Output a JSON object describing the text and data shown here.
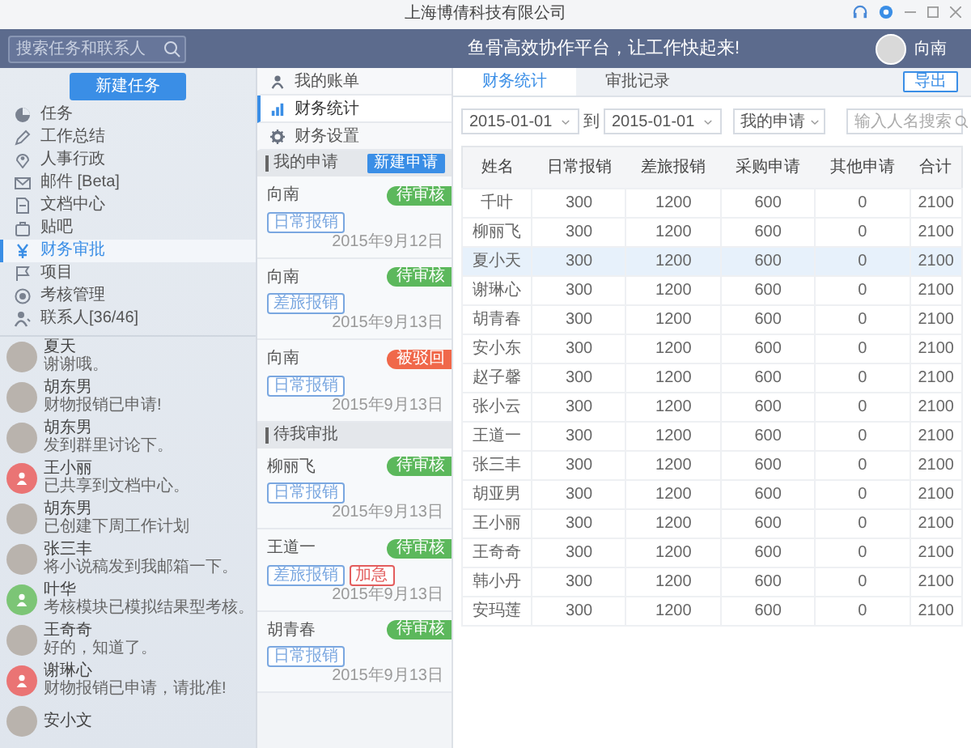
{
  "window": {
    "title": "上海博倩科技有限公司"
  },
  "header": {
    "search_placeholder": "搜索任务和联系人",
    "slogan": "鱼骨高效协作平台，让工作快起来!",
    "user": "向南"
  },
  "sidebar": {
    "new_button": "新建任务",
    "items": [
      {
        "label": "任务",
        "selected": false
      },
      {
        "label": "工作总结",
        "selected": false
      },
      {
        "label": "人事行政",
        "selected": false
      },
      {
        "label": "邮件 [Beta]",
        "selected": false
      },
      {
        "label": "文档中心",
        "selected": false
      },
      {
        "label": "贴吧",
        "selected": false
      },
      {
        "label": "财务审批",
        "selected": true
      },
      {
        "label": "项目",
        "selected": false
      },
      {
        "label": "考核管理",
        "selected": false
      },
      {
        "label": "联系人[36/46]",
        "selected": false
      }
    ],
    "contacts": [
      {
        "name": "夏天",
        "message": "谢谢哦。",
        "kind": "photo"
      },
      {
        "name": "胡东男",
        "message": "财物报销已申请!",
        "kind": "photo"
      },
      {
        "name": "胡东男",
        "message": "发到群里讨论下。",
        "kind": "photo"
      },
      {
        "name": "王小丽",
        "message": "已共享到文档中心。",
        "kind": "icon",
        "color": "#ea7474"
      },
      {
        "name": "胡东男",
        "message": "已创建下周工作计划",
        "kind": "photo"
      },
      {
        "name": "张三丰",
        "message": "将小说稿发到我邮箱一下。",
        "kind": "photo"
      },
      {
        "name": "叶华",
        "message": "考核模块已模拟结果型考核。",
        "kind": "icon",
        "color": "#7cc576"
      },
      {
        "name": "王奇奇",
        "message": "好的，知道了。",
        "kind": "photo"
      },
      {
        "name": "谢琳心",
        "message": "财物报销已申请，请批准!",
        "kind": "icon",
        "color": "#ea7474"
      },
      {
        "name": "安小文",
        "kind": "photo"
      }
    ]
  },
  "finance_menu": {
    "items": [
      {
        "label": "我的账单",
        "selected": false
      },
      {
        "label": "财务统计",
        "selected": true
      },
      {
        "label": "财务设置",
        "selected": false
      }
    ],
    "sections": [
      {
        "title": "我的申请",
        "button": "新建申请",
        "entries": [
          {
            "name": "向南",
            "status": {
              "text": "待审核",
              "color": "#5cb85c"
            },
            "tags": [
              {
                "text": "日常报销",
                "color": "#7aa7e0"
              }
            ],
            "date": "2015年9月12日"
          },
          {
            "name": "向南",
            "status": {
              "text": "待审核",
              "color": "#5cb85c"
            },
            "tags": [
              {
                "text": "差旅报销",
                "color": "#7aa7e0"
              }
            ],
            "date": "2015年9月13日"
          },
          {
            "name": "向南",
            "status": {
              "text": "被驳回",
              "color": "#f0684a"
            },
            "tags": [
              {
                "text": "日常报销",
                "color": "#7aa7e0"
              }
            ],
            "date": "2015年9月13日"
          }
        ]
      },
      {
        "title": "待我审批",
        "entries": [
          {
            "name": "柳丽飞",
            "status": {
              "text": "待审核",
              "color": "#5cb85c"
            },
            "tags": [
              {
                "text": "日常报销",
                "color": "#7aa7e0"
              }
            ],
            "date": "2015年9月13日"
          },
          {
            "name": "王道一",
            "status": {
              "text": "待审核",
              "color": "#5cb85c"
            },
            "tags": [
              {
                "text": "差旅报销",
                "color": "#7aa7e0"
              },
              {
                "text": "加急",
                "color": "#e35d5d"
              }
            ],
            "date": "2015年9月13日"
          },
          {
            "name": "胡青春",
            "status": {
              "text": "待审核",
              "color": "#5cb85c"
            },
            "tags": [
              {
                "text": "日常报销",
                "color": "#7aa7e0"
              }
            ],
            "date": "2015年9月13日"
          }
        ]
      }
    ]
  },
  "main": {
    "tabs": [
      {
        "label": "财务统计",
        "selected": true
      },
      {
        "label": "审批记录",
        "selected": false
      }
    ],
    "export_button": "导出",
    "filters": {
      "start_date": "2015-01-01",
      "to": "到",
      "end_date": "2015-01-01",
      "scope": "我的申请",
      "search_placeholder": "输入人名搜索"
    },
    "table": {
      "columns": [
        "姓名",
        "日常报销",
        "差旅报销",
        "采购申请",
        "其他申请",
        "合计"
      ],
      "rows": [
        {
          "cells": [
            "千叶",
            "300",
            "1200",
            "600",
            "0",
            "2100"
          ],
          "selected": false
        },
        {
          "cells": [
            "柳丽飞",
            "300",
            "1200",
            "600",
            "0",
            "2100"
          ],
          "selected": false
        },
        {
          "cells": [
            "夏小天",
            "300",
            "1200",
            "600",
            "0",
            "2100"
          ],
          "selected": true
        },
        {
          "cells": [
            "谢琳心",
            "300",
            "1200",
            "600",
            "0",
            "2100"
          ],
          "selected": false
        },
        {
          "cells": [
            "胡青春",
            "300",
            "1200",
            "600",
            "0",
            "2100"
          ],
          "selected": false
        },
        {
          "cells": [
            "安小东",
            "300",
            "1200",
            "600",
            "0",
            "2100"
          ],
          "selected": false
        },
        {
          "cells": [
            "赵子馨",
            "300",
            "1200",
            "600",
            "0",
            "2100"
          ],
          "selected": false
        },
        {
          "cells": [
            "张小云",
            "300",
            "1200",
            "600",
            "0",
            "2100"
          ],
          "selected": false
        },
        {
          "cells": [
            "王道一",
            "300",
            "1200",
            "600",
            "0",
            "2100"
          ],
          "selected": false
        },
        {
          "cells": [
            "张三丰",
            "300",
            "1200",
            "600",
            "0",
            "2100"
          ],
          "selected": false
        },
        {
          "cells": [
            "胡亚男",
            "300",
            "1200",
            "600",
            "0",
            "2100"
          ],
          "selected": false
        },
        {
          "cells": [
            "王小丽",
            "300",
            "1200",
            "600",
            "0",
            "2100"
          ],
          "selected": false
        },
        {
          "cells": [
            "王奇奇",
            "300",
            "1200",
            "600",
            "0",
            "2100"
          ],
          "selected": false
        },
        {
          "cells": [
            "韩小丹",
            "300",
            "1200",
            "600",
            "0",
            "2100"
          ],
          "selected": false
        },
        {
          "cells": [
            "安玛莲",
            "300",
            "1200",
            "600",
            "0",
            "2100"
          ],
          "selected": false
        }
      ]
    }
  }
}
